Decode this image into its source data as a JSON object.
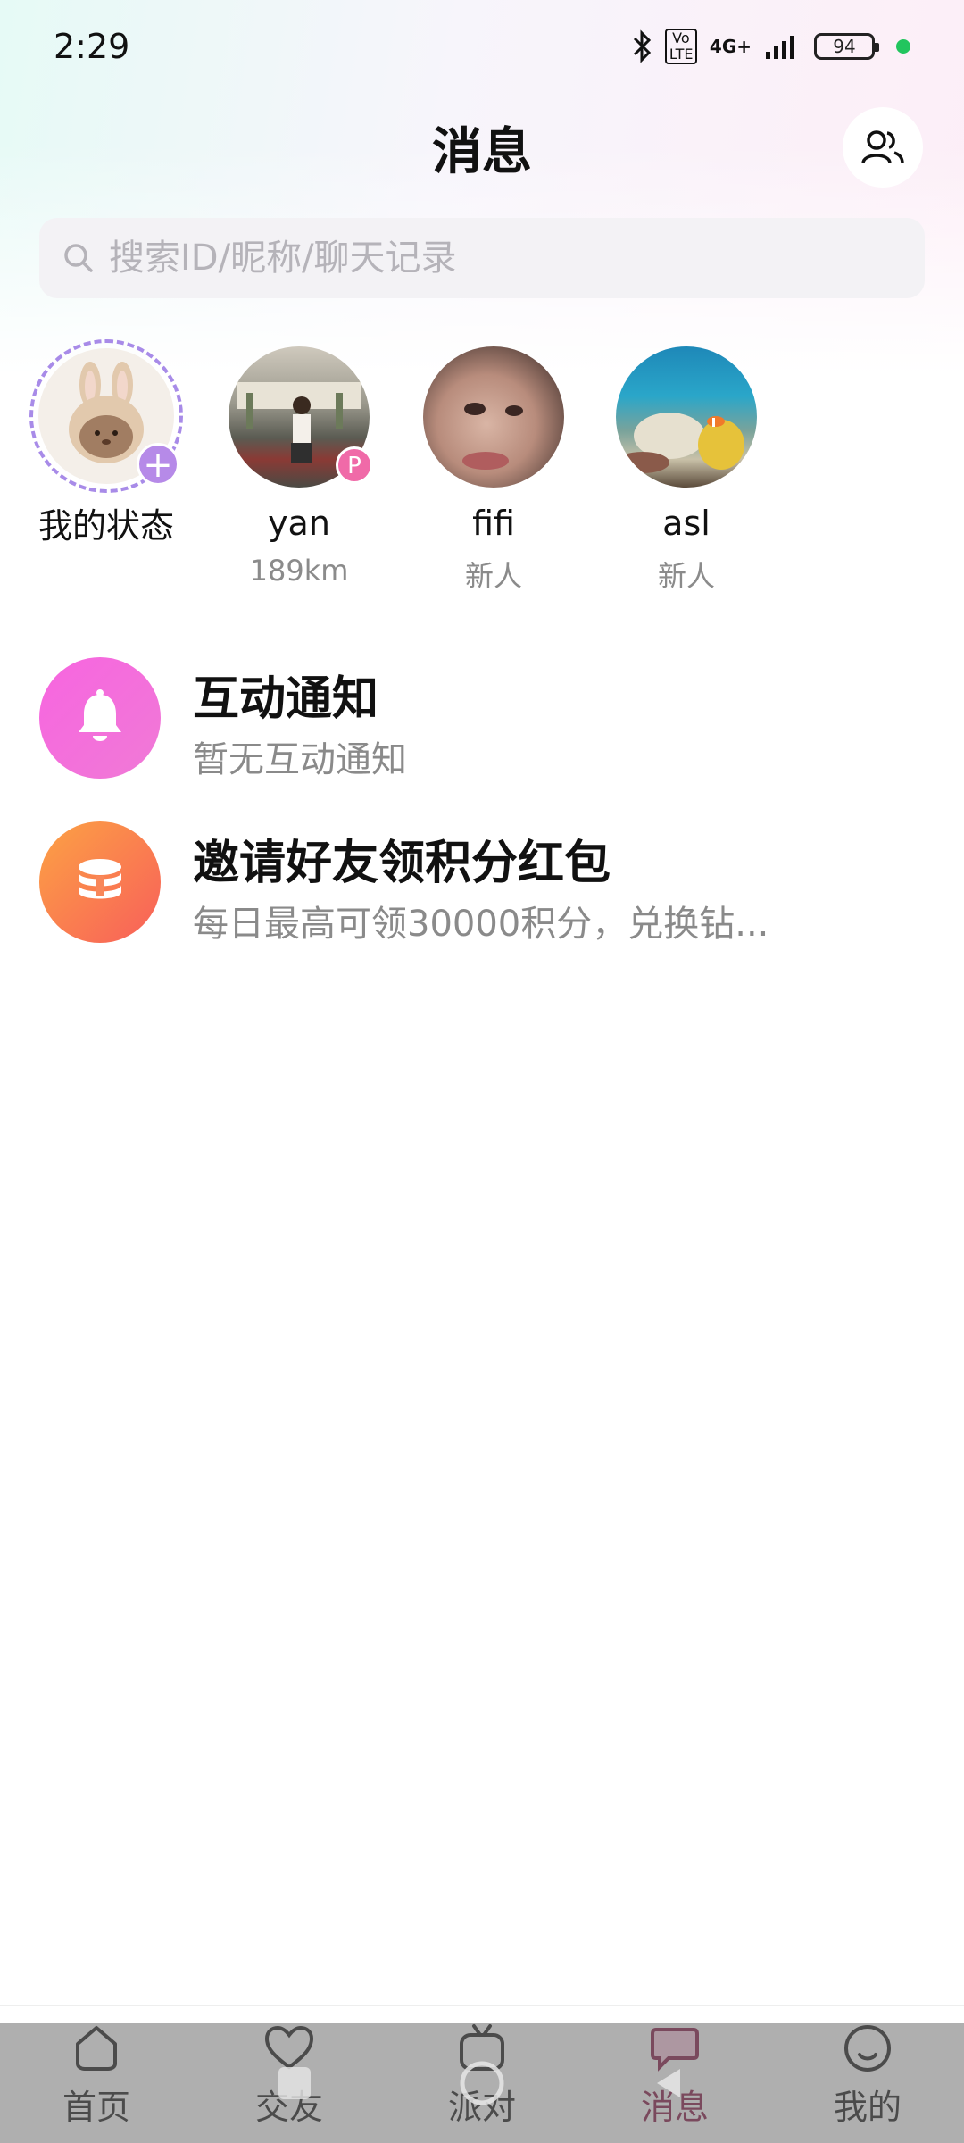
{
  "status_bar": {
    "time": "2:29",
    "network": "4G+",
    "volte": "Vo LTE",
    "battery": "94"
  },
  "header": {
    "title": "消息"
  },
  "search": {
    "placeholder": "搜索ID/昵称/聊天记录"
  },
  "stories": [
    {
      "name": "我的状态",
      "sub": ""
    },
    {
      "name": "yan",
      "sub": "189km",
      "badge": "P"
    },
    {
      "name": "fifi",
      "sub": "新人"
    },
    {
      "name": "asl",
      "sub": "新人"
    }
  ],
  "list": [
    {
      "title": "互动通知",
      "sub": "暂无互动通知",
      "icon": "bell-icon",
      "color": "#f26bd6"
    },
    {
      "title": "邀请好友领积分红包",
      "sub": "每日最高可领30000积分，兑换钻...",
      "icon": "coins-icon",
      "color": "#fb7d4d"
    }
  ],
  "tabbar": {
    "items": [
      {
        "label": "首页",
        "icon": "home-icon"
      },
      {
        "label": "交友",
        "icon": "heart-icon"
      },
      {
        "label": "派对",
        "icon": "tv-icon"
      },
      {
        "label": "消息",
        "icon": "message-icon",
        "active": true
      },
      {
        "label": "我的",
        "icon": "profile-icon"
      }
    ],
    "active_color": "#8b1d4a"
  }
}
